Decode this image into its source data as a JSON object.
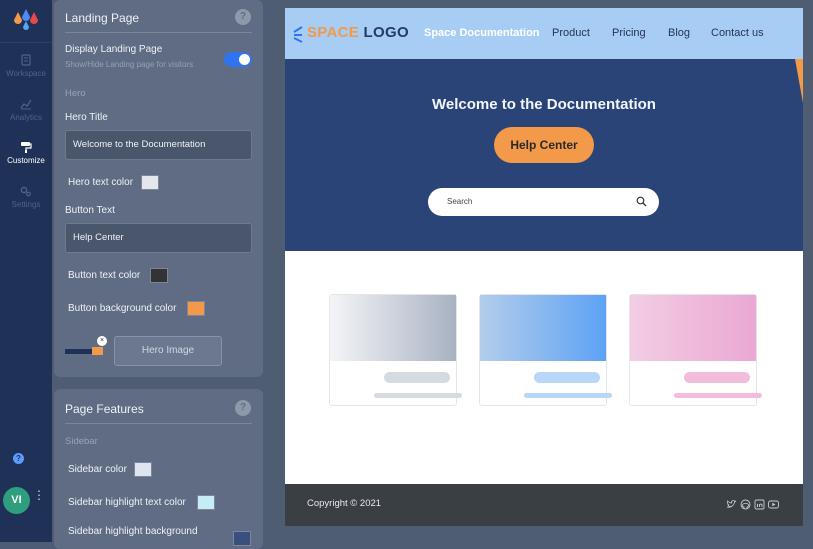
{
  "rail": {
    "items": [
      {
        "label": "Workspace",
        "icon": "document-icon",
        "active": false
      },
      {
        "label": "Analytics",
        "icon": "chart-icon",
        "active": false
      },
      {
        "label": "Customize",
        "icon": "paint-roller-icon",
        "active": true
      },
      {
        "label": "Settings",
        "icon": "gears-icon",
        "active": false
      }
    ],
    "help_label": "?",
    "avatar_initials": "VI",
    "more_label": "⋮"
  },
  "landing_panel": {
    "title": "Landing Page",
    "help": "?",
    "display_label": "Display Landing Page",
    "display_desc": "Show/Hide Landing page for visitors",
    "display_on": true,
    "hero_section": "Hero",
    "hero_title_label": "Hero Title",
    "hero_title_value": "Welcome to the Documentation",
    "hero_text_color_label": "Hero text color",
    "hero_text_color": "#e4e7ec",
    "button_text_label": "Button Text",
    "button_text_value": "Help Center",
    "button_text_color_label": "Button text color",
    "button_text_color": "#333333",
    "button_bg_color_label": "Button background color",
    "button_bg_color": "#f2994a",
    "hero_image_button": "Hero Image",
    "remove_label": "×"
  },
  "features_panel": {
    "title": "Page Features",
    "help": "?",
    "sidebar_section": "Sidebar",
    "sidebar_color_label": "Sidebar color",
    "sidebar_color": "#dfe5ee",
    "highlight_text_label": "Sidebar highlight text color",
    "highlight_text_color": "#c6ecf8",
    "highlight_bg_label": "Sidebar highlight background",
    "highlight_bg_color": "#3b4f7e"
  },
  "preview": {
    "brand_part1": "SPACE",
    "brand_part2": "LOGO",
    "nav": [
      "Space Documentation",
      "Product",
      "Pricing",
      "Blog",
      "Contact us"
    ],
    "hero_title": "Welcome to the Documentation",
    "hero_button": "Help Center",
    "search_placeholder": "Search",
    "footer_copyright": "Copyright © 2021",
    "social_icons": [
      "twitter-icon",
      "github-icon",
      "linkedin-icon",
      "youtube-icon"
    ],
    "colors": {
      "topbar": "#a8cdf5",
      "hero": "#2b4478",
      "accent": "#f2994a",
      "footer": "#3a3f44"
    }
  }
}
